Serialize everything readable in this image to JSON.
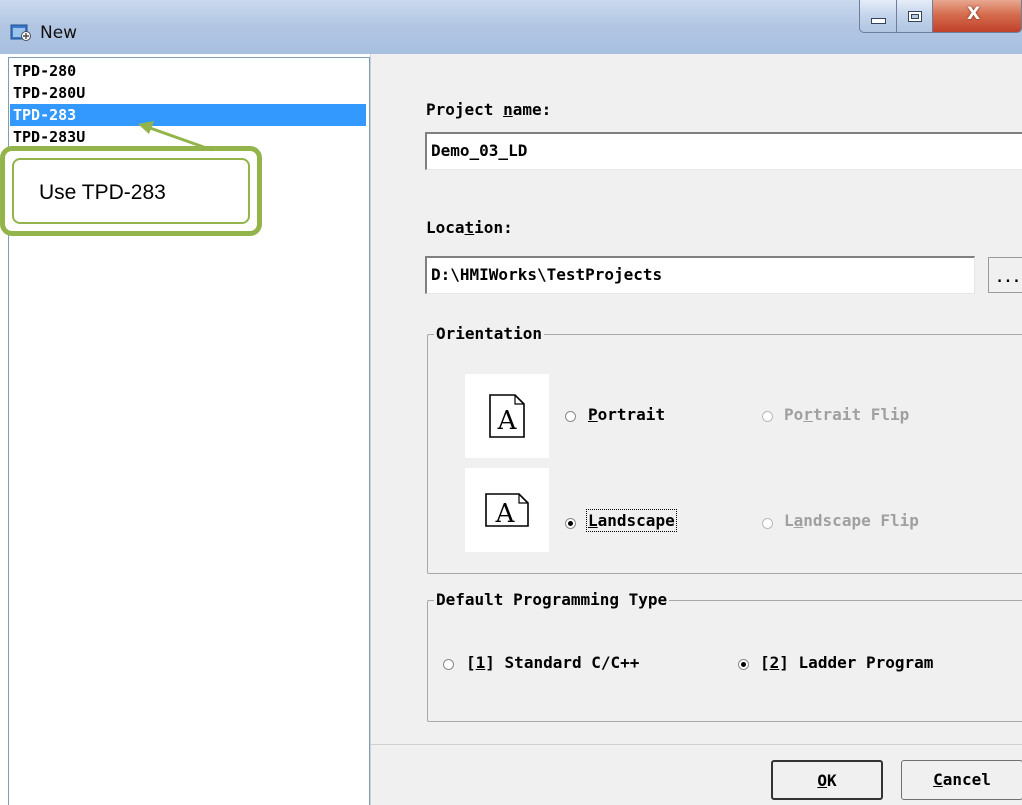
{
  "window": {
    "title": "New",
    "icon": "new-project-icon",
    "controls": {
      "minimize": "minimize-icon",
      "maximize": "maximize-icon",
      "close_label": "X"
    }
  },
  "device_list": {
    "items": [
      {
        "label": "TPD-280",
        "selected": false
      },
      {
        "label": "TPD-280U",
        "selected": false
      },
      {
        "label": "TPD-283",
        "selected": true
      },
      {
        "label": "TPD-283U",
        "selected": false
      }
    ]
  },
  "annotation": {
    "callout_text": "Use TPD-283",
    "color": "#93b44b"
  },
  "form": {
    "project_name": {
      "label": "Project ",
      "label_u": "n",
      "label_rest": "ame:",
      "value": "Demo_03_LD"
    },
    "location": {
      "label": "Loca",
      "label_u": "t",
      "label_rest": "ion:",
      "value": "D:\\HMIWorks\\TestProjects",
      "browse_label": "..."
    },
    "orientation": {
      "title": "Orientation",
      "options": {
        "portrait": {
          "u": "P",
          "rest": "ortrait",
          "checked": false,
          "enabled": true
        },
        "portrait_flip": {
          "pre": "Po",
          "u": "r",
          "rest": "trait Flip",
          "checked": false,
          "enabled": false
        },
        "landscape": {
          "u": "L",
          "rest": "andscape",
          "checked": true,
          "enabled": true
        },
        "landscape_flip": {
          "pre": "L",
          "u": "a",
          "rest": "ndscape Flip",
          "checked": false,
          "enabled": false
        }
      },
      "icon_glyph": "A"
    },
    "programming_type": {
      "title": "Default Programming Type",
      "options": {
        "standard": {
          "pre": "[",
          "u": "1",
          "rest": "] Standard C/C++",
          "checked": false
        },
        "ladder": {
          "pre": "[",
          "u": "2",
          "rest": "] Ladder Program",
          "checked": true
        }
      }
    }
  },
  "buttons": {
    "ok": {
      "u": "O",
      "rest": "K"
    },
    "cancel": {
      "u": "C",
      "rest": "ancel"
    }
  },
  "colors": {
    "selection": "#3399ff",
    "titlebar": "#b3c7e4",
    "close": "#c0402a"
  }
}
